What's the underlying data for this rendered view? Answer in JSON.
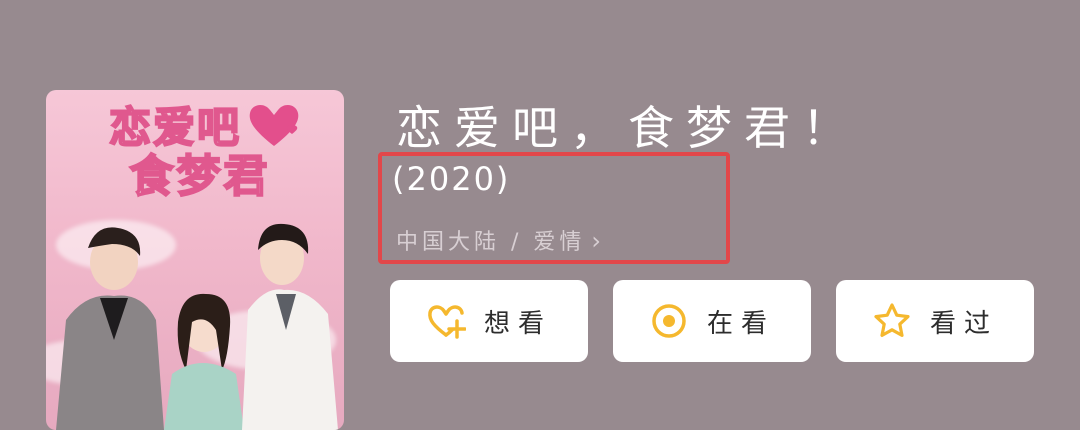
{
  "poster": {
    "title_line1": "恋爱吧",
    "title_line2": "食梦君"
  },
  "movie": {
    "title": "恋爱吧，食梦君！",
    "year": "(2020)",
    "meta": "中国大陆 / 爱情",
    "meta_chevron": "›"
  },
  "actions": {
    "want": {
      "label": "想看",
      "icon": "heart-plus-icon",
      "color": "#f5b82e"
    },
    "watching": {
      "label": "在看",
      "icon": "target-circle-icon",
      "color": "#f5b82e"
    },
    "watched": {
      "label": "看过",
      "icon": "star-icon",
      "color": "#f5b82e"
    }
  },
  "colors": {
    "background": "#978a8f",
    "highlight": "#e2474a",
    "accent": "#f5b82e"
  }
}
